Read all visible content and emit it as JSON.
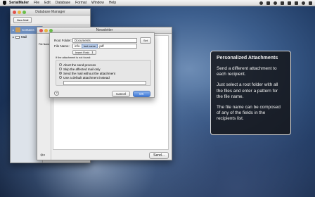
{
  "menubar": {
    "items": [
      "SerialMailer",
      "File",
      "Edit",
      "Database",
      "Format",
      "Window",
      "Help"
    ]
  },
  "db_window": {
    "title": "Database Manager",
    "new_mail_button": "New Mail",
    "items": [
      "Contacts",
      "Mail"
    ]
  },
  "newsletter_window": {
    "title": "Newsletter",
    "sidebar_label": "File Name",
    "send_button": "Send..."
  },
  "sheet": {
    "root_folder_label": "Root Folder:",
    "root_folder_value": "Documents",
    "set_button": "Set",
    "file_name_label": "File Name:",
    "file_name_prefix": "info-",
    "file_name_token": "last name",
    "file_name_suffix": ".pdf",
    "insert_field_popup": "Insert Field",
    "not_found_label": "If the attachment is not found:",
    "options": [
      "Abort the send process",
      "Skip the affected mail only",
      "Send the mail without the attachment",
      "Use a default attachment instead"
    ],
    "selected_option": 2,
    "cancel_button": "Cancel",
    "ok_button": "OK",
    "help_button": "?"
  },
  "info_panel": {
    "title": "Personalized Attachments",
    "paragraphs": [
      "Send a different attachment to each recipient.",
      "Just select a root folder with all the files and enter a pattern for the file name.",
      "The file name can be composed of any of the fields in the recipients list."
    ]
  }
}
